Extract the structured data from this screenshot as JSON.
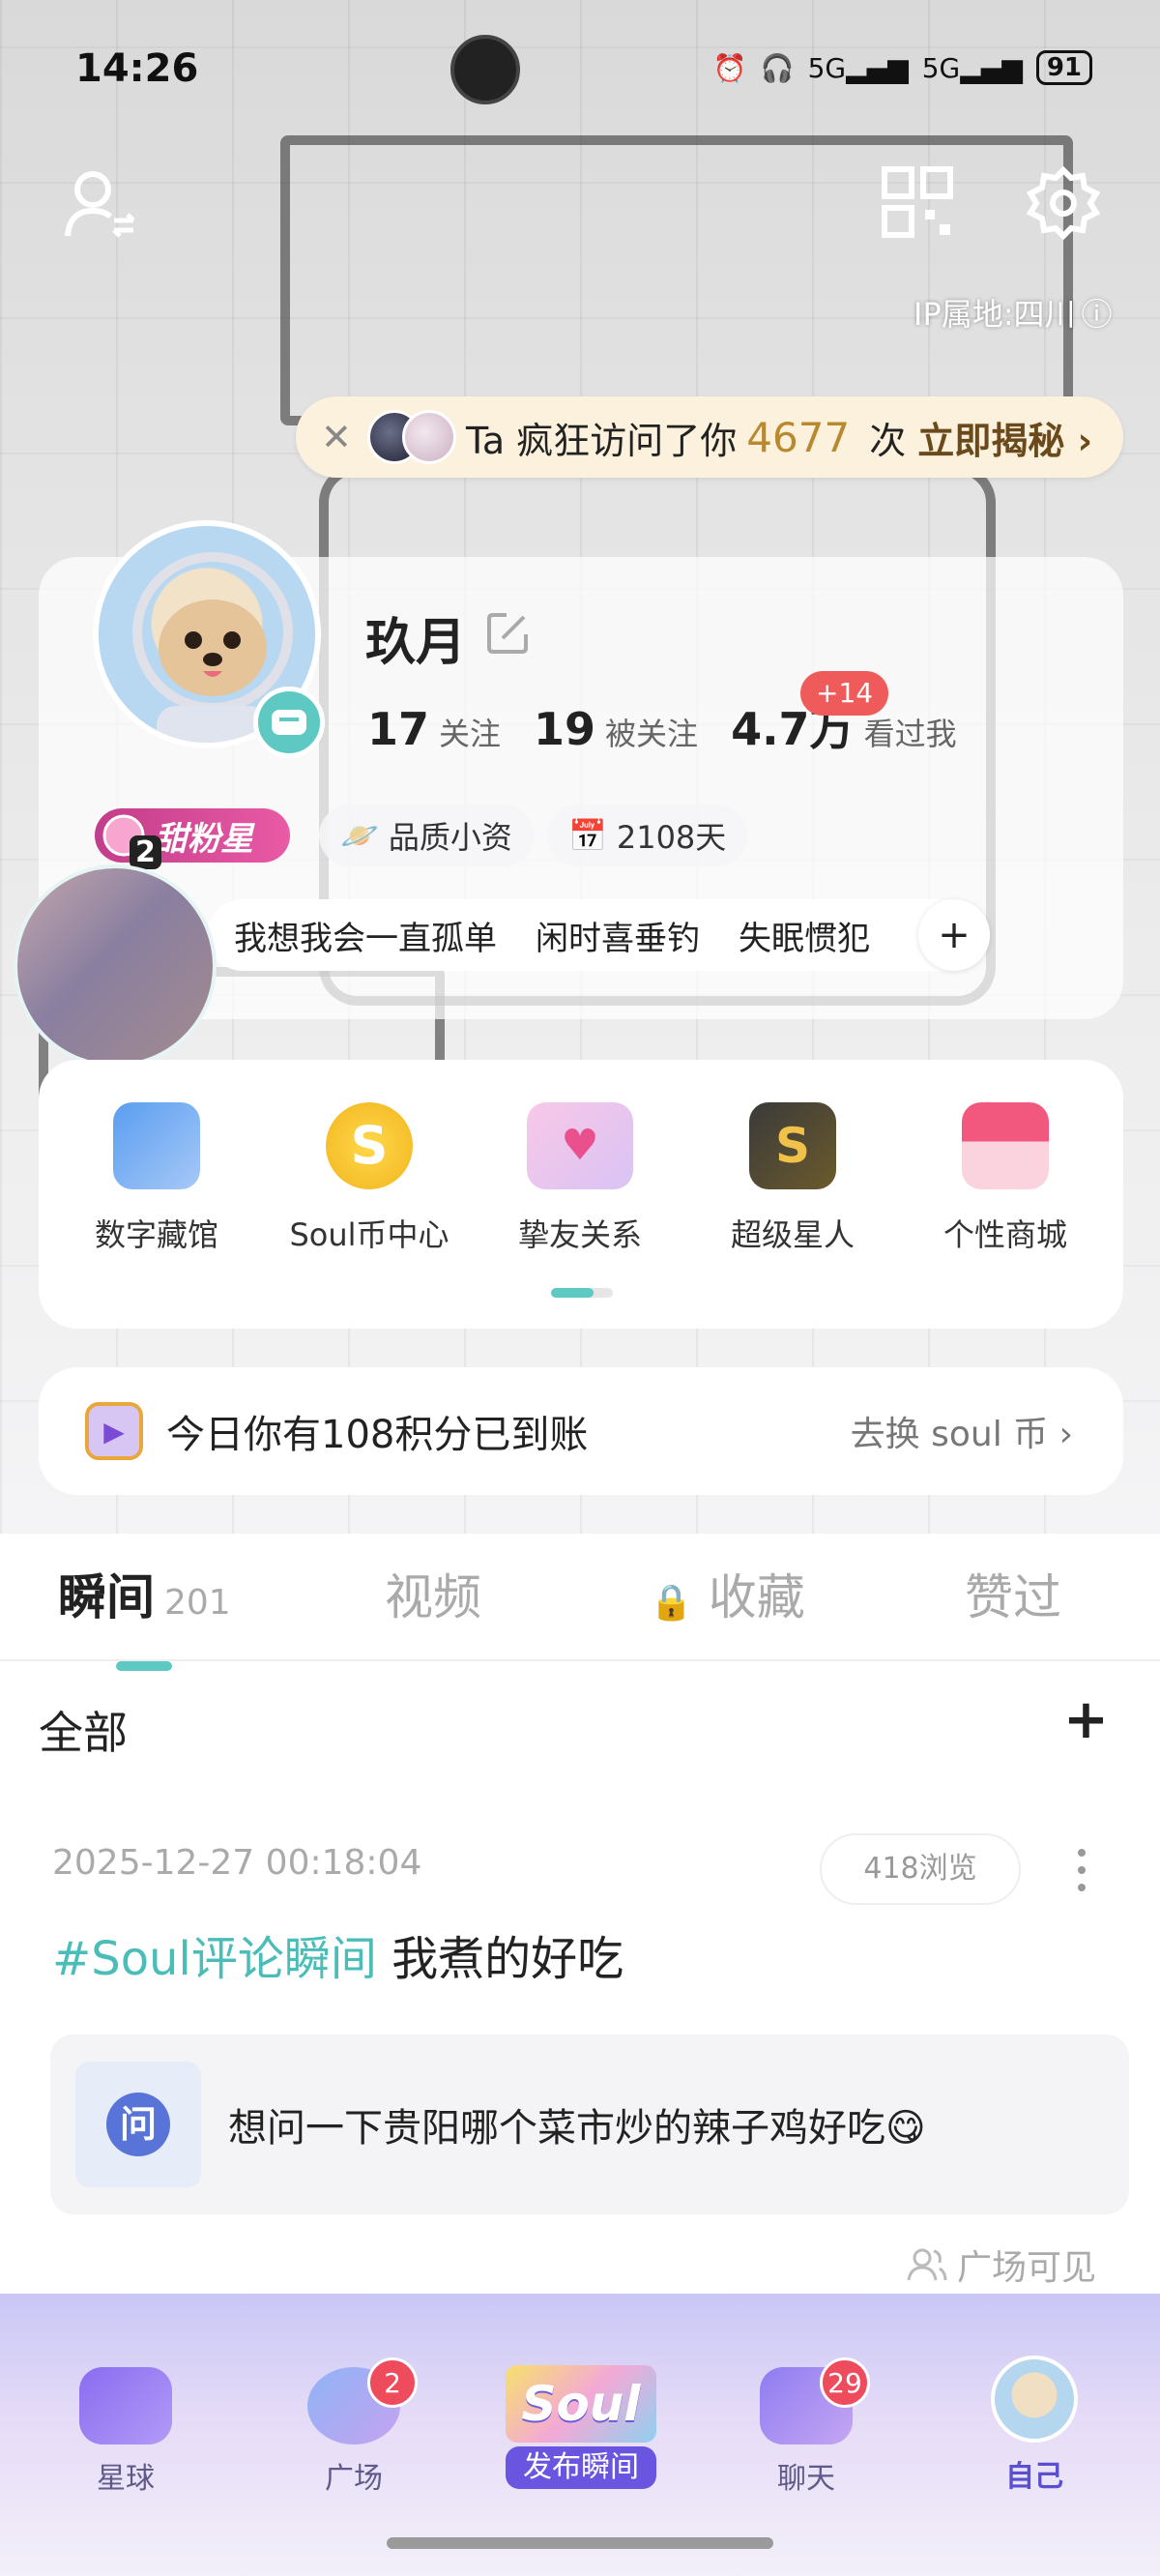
{
  "status_bar": {
    "time": "14:26",
    "network": "5G",
    "network2": "5G",
    "battery": "91"
  },
  "header": {
    "ip_location": "IP属地:四川"
  },
  "visitor_banner": {
    "prefix": "Ta 疯狂访问了你",
    "count": "4677",
    "suffix": "次",
    "link": "立即揭秘"
  },
  "profile": {
    "nickname": "玖月",
    "stats": [
      {
        "value": "17",
        "label": "关注"
      },
      {
        "value": "19",
        "label": "被关注"
      },
      {
        "value": "4.7万",
        "label": "看过我"
      }
    ],
    "views_increment": "+14",
    "level_badge": "甜粉星",
    "level_num": "2",
    "chips": [
      "品质小资",
      "2108天"
    ],
    "tags": [
      "我想我会一直孤单",
      "闲时喜垂钓",
      "失眠惯犯"
    ],
    "tag_add": "+"
  },
  "services": [
    {
      "label": "数字藏馆",
      "icon": "digital-collection-icon"
    },
    {
      "label": "Soul币中心",
      "icon": "soul-coin-icon"
    },
    {
      "label": "挚友关系",
      "icon": "friendship-envelope-icon"
    },
    {
      "label": "超级星人",
      "icon": "super-star-icon"
    },
    {
      "label": "个性商城",
      "icon": "shop-icon"
    }
  ],
  "points_banner": {
    "text": "今日你有108积分已到账",
    "link": "去换 soul 币 ›"
  },
  "tabs": [
    {
      "label": "瞬间",
      "count": "201"
    },
    {
      "label": "视频"
    },
    {
      "label": "收藏"
    },
    {
      "label": "赞过"
    }
  ],
  "filter": {
    "label": "全部",
    "add": "+"
  },
  "post": {
    "timestamp": "2025-12-27 00:18:04",
    "views": "418浏览",
    "hashtag": "#Soul评论瞬间",
    "text": " 我煮的好吃",
    "qa_text": "想问一下贵阳哪个菜市炒的辣子鸡好吃😋",
    "qa_icon_letter": "问",
    "visibility": "广场可见"
  },
  "bottom_nav": [
    {
      "label": "星球"
    },
    {
      "label": "广场",
      "badge": "2"
    },
    {
      "label": "发布瞬间",
      "logo": "Soul"
    },
    {
      "label": "聊天",
      "badge": "29"
    },
    {
      "label": "自己"
    }
  ],
  "colors": {
    "accent": "#5ec9c3",
    "badge_red": "#ee4b5d",
    "nav_purple": "#5a4fcf"
  }
}
